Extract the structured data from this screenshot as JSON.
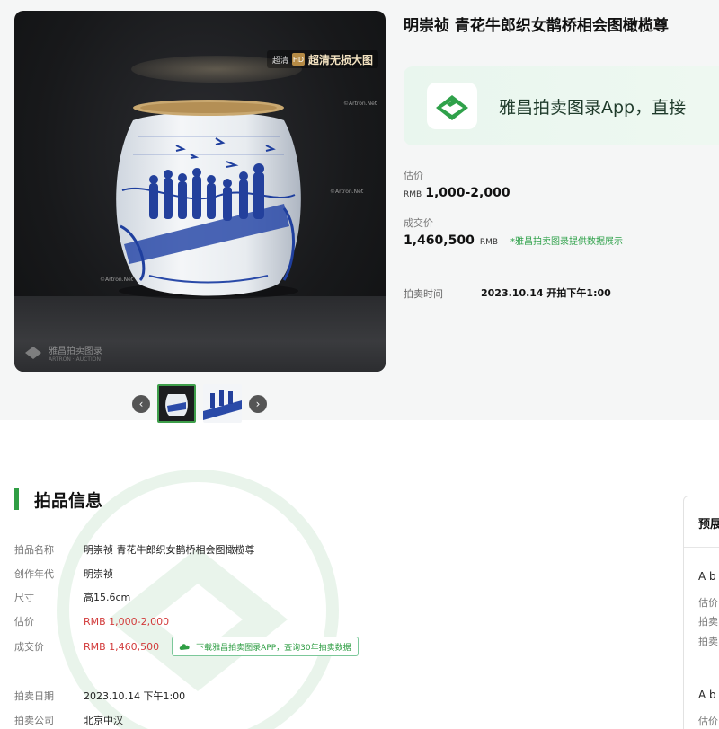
{
  "lot": {
    "title": "明崇祯 青花牛郎织女鹊桥相会图橄榄尊",
    "image_badge_small": "超清",
    "image_badge_icon": "HD",
    "image_badge_text": "超清无损大图",
    "image_watermark": "©Artron.Net",
    "image_logo_text": "雅昌拍卖图录",
    "image_logo_sub": "ARTRON · AUCTION"
  },
  "promo": {
    "text": "雅昌拍卖图录App，直接"
  },
  "price": {
    "estimate_label": "估价",
    "estimate_currency": "RMB",
    "estimate_value": "1,000-2,000",
    "deal_label": "成交价",
    "deal_value": "1,460,500",
    "deal_currency": "RMB",
    "deal_note": "*雅昌拍卖图录提供数据展示",
    "time_label": "拍卖时间",
    "time_value": "2023.10.14 开拍下午1:00"
  },
  "section": {
    "title": "拍品信息"
  },
  "info": [
    {
      "key": "拍品名称",
      "value": "明崇祯 青花牛郎织女鹊桥相会图橄榄尊"
    },
    {
      "key": "创作年代",
      "value": "明崇祯"
    },
    {
      "key": "尺寸",
      "value": "高15.6cm"
    },
    {
      "key": "估价",
      "value": "RMB 1,000-2,000"
    },
    {
      "key": "成交价",
      "value": "RMB 1,460,500"
    },
    {
      "key": "拍卖日期",
      "value": "2023.10.14 下午1:00"
    },
    {
      "key": "拍卖公司",
      "value": "北京中汉"
    }
  ],
  "download_button": "下载雅昌拍卖图录APP，查询30年拍卖数据",
  "side_panel": {
    "title": "预展",
    "item1": "A b",
    "item1_sub1": "估价",
    "item1_sub2": "拍卖",
    "item1_sub3": "拍卖",
    "item2": "A b",
    "item2_sub1": "估价"
  },
  "colors": {
    "accent_green": "#2f9e44",
    "price_red": "#d23b3b",
    "cobalt_blue": "#1f3f9e"
  }
}
